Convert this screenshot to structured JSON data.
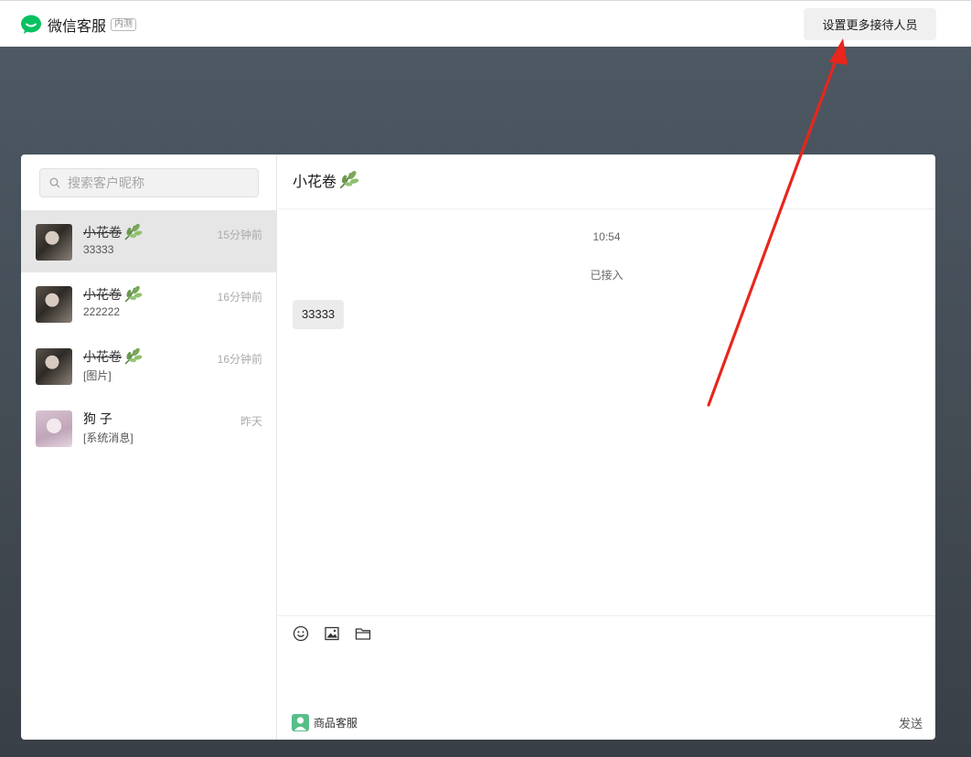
{
  "app": {
    "title": "微信客服",
    "badge": "内测",
    "top_button": "设置更多接待人员"
  },
  "colors": {
    "brand_green": "#07c160",
    "arrow_red": "#e8261c",
    "active_row": "#e6e6e6"
  },
  "search": {
    "placeholder": "搜索客户昵称",
    "value": ""
  },
  "conversations": [
    {
      "name": "小花卷",
      "name_struck": true,
      "leaf_icon": "leaf-emoji-icon",
      "preview": "33333",
      "time": "15分钟前",
      "avatar": "avatar-dark",
      "active": true
    },
    {
      "name": "小花卷",
      "name_struck": true,
      "leaf_icon": "leaf-emoji-icon",
      "preview": "222222",
      "time": "16分钟前",
      "avatar": "avatar-dark",
      "active": false
    },
    {
      "name": "小花卷",
      "name_struck": true,
      "leaf_icon": "leaf-emoji-icon",
      "preview": "[图片]",
      "time": "16分钟前",
      "avatar": "avatar-dark",
      "active": false
    },
    {
      "name": "狗 子",
      "name_struck": false,
      "leaf_icon": "",
      "preview": "[系统消息]",
      "time": "昨天",
      "avatar": "avatar-pink",
      "active": false
    }
  ],
  "chat": {
    "title": "小花卷",
    "timestamp": "10:54",
    "system_note": "已接入",
    "messages": [
      {
        "text": "33333",
        "from": "customer"
      }
    ]
  },
  "composer": {
    "tools": [
      "emoji-icon",
      "image-icon",
      "folder-icon"
    ],
    "agent_label": "商品客服",
    "send_label": "发送"
  }
}
